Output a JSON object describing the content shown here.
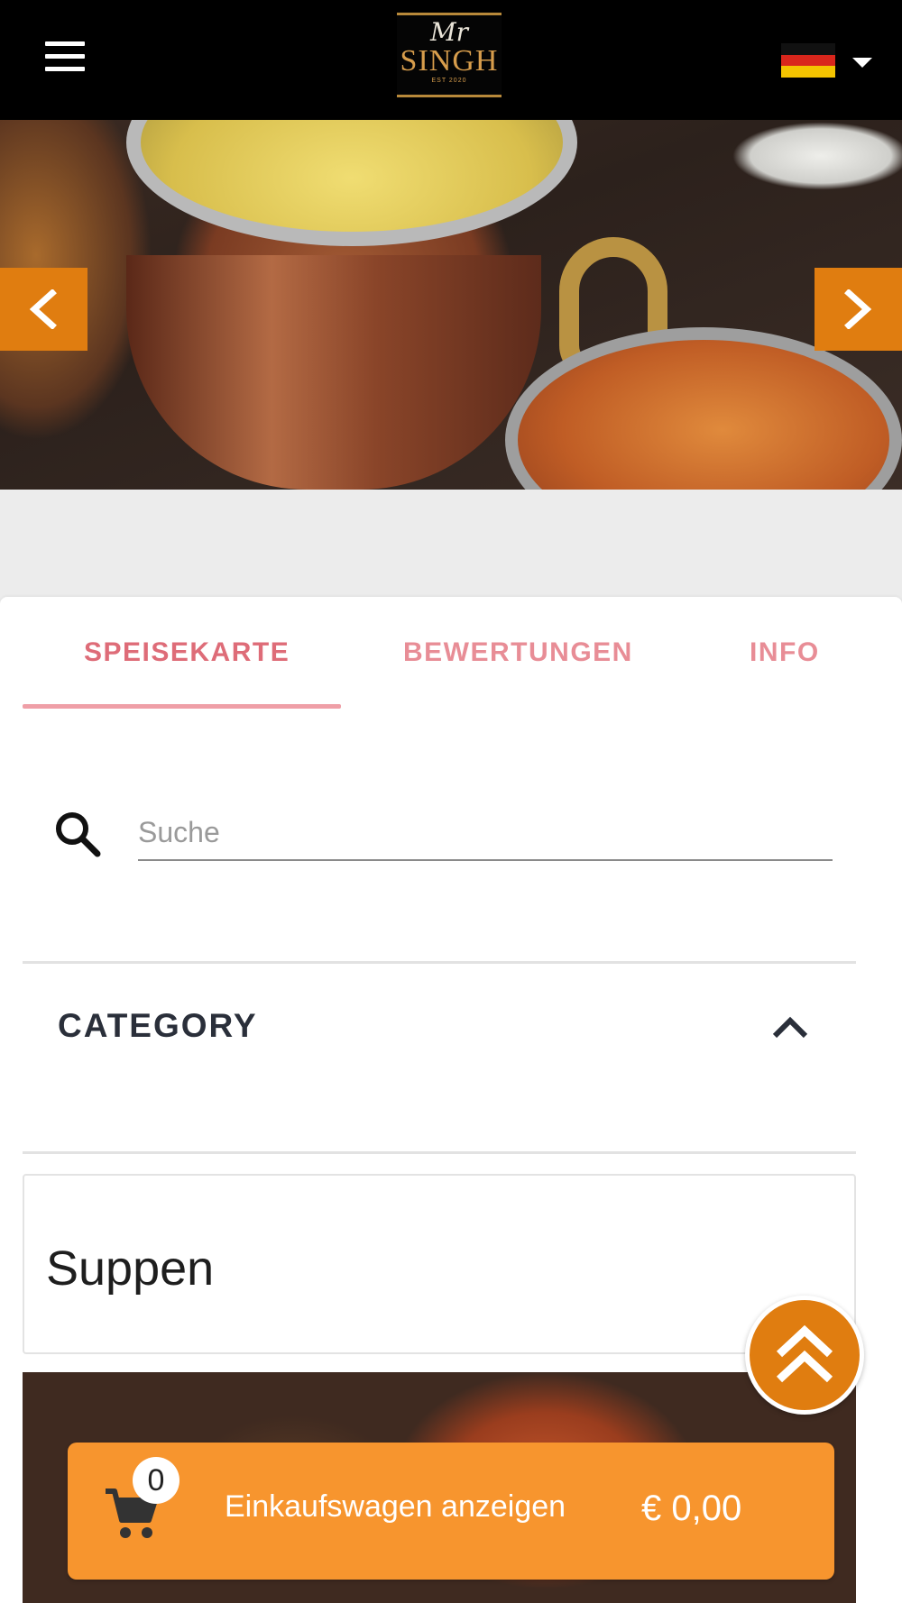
{
  "header": {
    "logo": {
      "top_text": "Mr",
      "main_text": "SINGH",
      "sub_text": "EST 2020"
    },
    "language": {
      "flag_icon": "germany-flag-icon",
      "selected": "de"
    }
  },
  "hero": {
    "prev_icon": "chevron-left-icon",
    "next_icon": "chevron-right-icon"
  },
  "tabs": [
    {
      "label": "SPEISEKARTE",
      "active": true
    },
    {
      "label": "BEWERTUNGEN",
      "active": false
    },
    {
      "label": "INFO",
      "active": false
    }
  ],
  "search": {
    "placeholder": "Suche",
    "value": ""
  },
  "category": {
    "title": "CATEGORY",
    "expanded": true
  },
  "section": {
    "title": "Suppen"
  },
  "cart": {
    "count": "0",
    "label": "Einkaufswagen anzeigen",
    "total": "€ 0,00"
  },
  "colors": {
    "accent_orange": "#e07d10",
    "cart_orange": "#f7952e",
    "tab_pink": "#de6c78"
  }
}
